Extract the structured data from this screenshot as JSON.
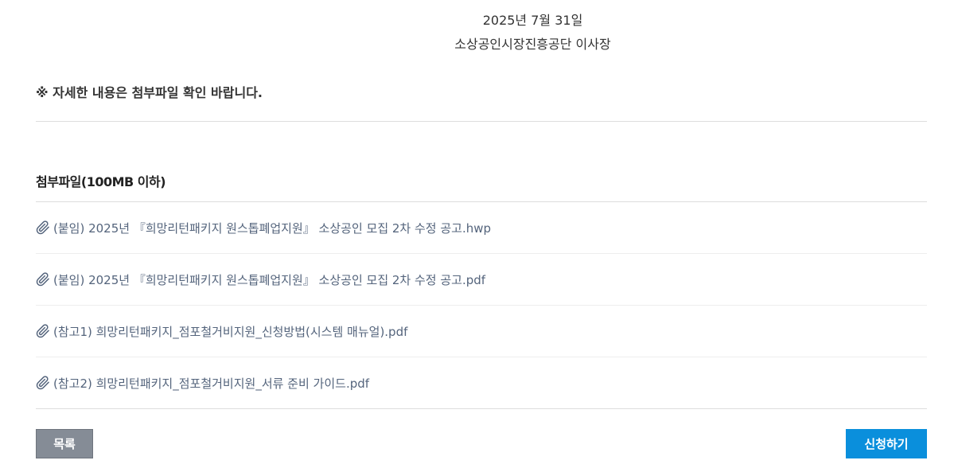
{
  "signature": {
    "date": "2025년 7월 31일",
    "organization": "소상공인시장진흥공단 이사장"
  },
  "notice": "※ 자세한 내용은 첨부파일 확인 바랍니다.",
  "attachments": {
    "title": "첨부파일(100MB 이하)",
    "icon": "paperclip-icon",
    "files": [
      "(붙임) 2025년 『희망리턴패키지 원스톱폐업지원』 소상공인 모집 2차 수정 공고.hwp",
      "(붙임) 2025년 『희망리턴패키지 원스톱폐업지원』 소상공인 모집 2차 수정 공고.pdf",
      "(참고1) 희망리턴패키지_점포철거비지원_신청방법(시스템 매뉴얼).pdf",
      "(참고2) 희망리턴패키지_점포철거비지원_서류 준비 가이드.pdf"
    ]
  },
  "buttons": {
    "list_label": "목록",
    "apply_label": "신청하기"
  },
  "colors": {
    "link": "#54647c",
    "list_button": "#858c96",
    "apply_button": "#0a8fdc"
  }
}
